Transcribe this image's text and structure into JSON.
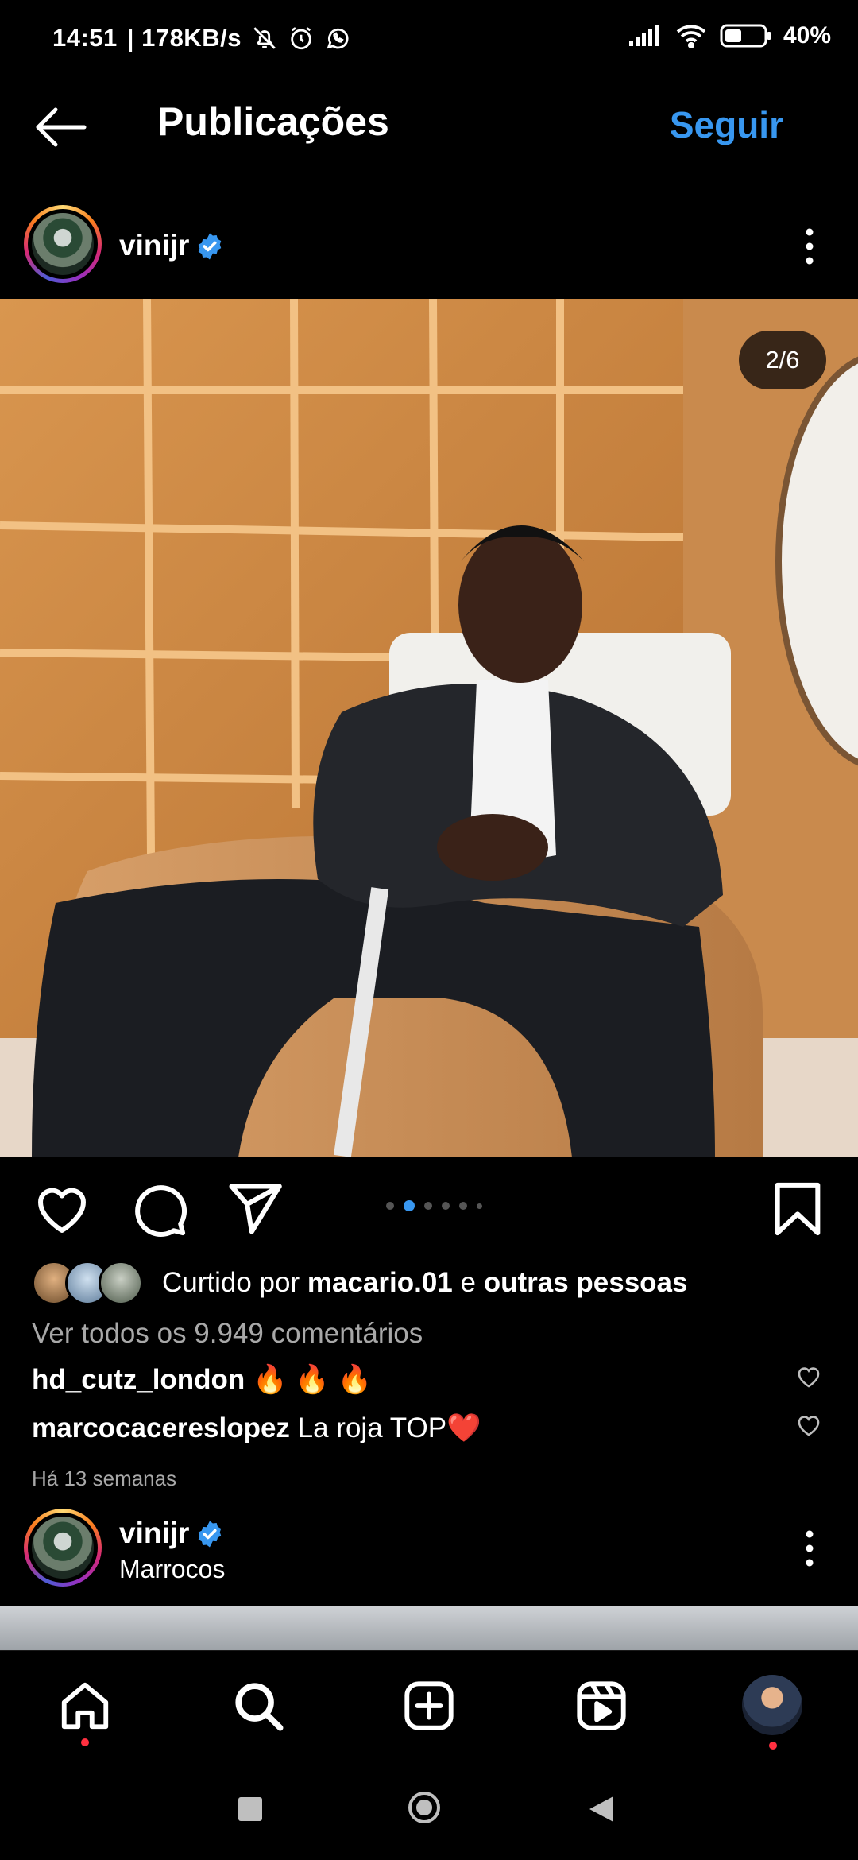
{
  "status_bar": {
    "time": "14:51",
    "speed": "| 178KB/s",
    "battery": "40%"
  },
  "header": {
    "title": "Publicações",
    "follow_label": "Seguir"
  },
  "post": {
    "username": "vinijr",
    "slide_counter": "2/6",
    "carousel": {
      "total": 6,
      "active_index": 1
    },
    "liked_by_prefix": "Curtido por ",
    "liked_by_user": "macario.01",
    "liked_by_and": " e ",
    "liked_by_others": "outras pessoas",
    "view_comments": "Ver todos os 9.949 comentários",
    "comments": [
      {
        "user": "hd_cutz_london",
        "text": "🔥 🔥 🔥"
      },
      {
        "user": "marcocacereslopez",
        "text": "La roja TOP❤️"
      }
    ],
    "time_ago": "Há 13 semanas"
  },
  "next_post": {
    "username": "vinijr",
    "location": "Marrocos"
  },
  "colors": {
    "accent": "#3897f0",
    "background": "#000000",
    "notification_dot": "#ff3040"
  },
  "icons": {
    "back": "arrow-left-icon",
    "verified": "verified-badge-icon",
    "more": "more-vertical-icon",
    "like": "heart-icon",
    "comment": "comment-icon",
    "share": "send-icon",
    "save": "bookmark-icon",
    "nav": [
      "home-icon",
      "search-icon",
      "add-post-icon",
      "reels-icon",
      "profile-avatar"
    ]
  }
}
